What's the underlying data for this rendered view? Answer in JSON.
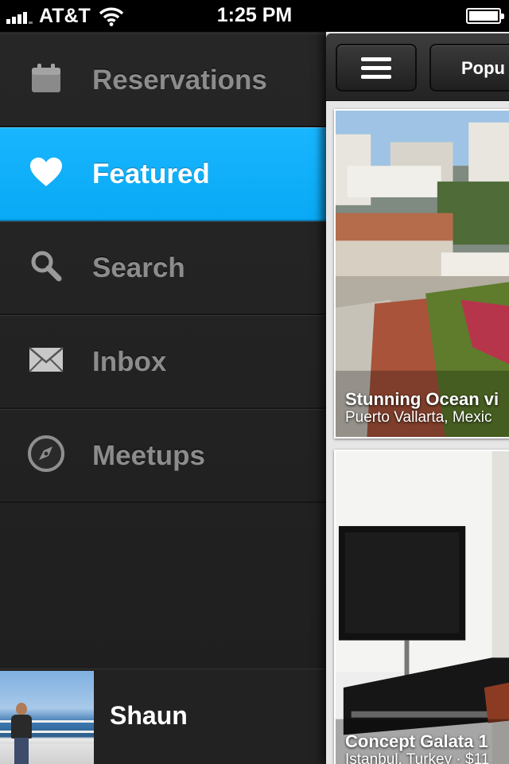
{
  "status_bar": {
    "carrier": "AT&T",
    "time": "1:25 PM",
    "signal_bars_filled": 4,
    "signal_bars_total": 5,
    "wifi_icon": "wifi-icon",
    "battery_icon": "battery-icon"
  },
  "sidebar": {
    "items": [
      {
        "label": "Reservations",
        "icon": "calendar-icon",
        "active": false
      },
      {
        "label": "Featured",
        "icon": "heart-icon",
        "active": true
      },
      {
        "label": "Search",
        "icon": "search-icon",
        "active": false
      },
      {
        "label": "Inbox",
        "icon": "envelope-icon",
        "active": false
      },
      {
        "label": "Meetups",
        "icon": "compass-icon",
        "active": false
      }
    ],
    "profile": {
      "name": "Shaun"
    }
  },
  "main": {
    "menu_button_icon": "hamburger-icon",
    "tab_label": "Popu",
    "listings": [
      {
        "title": "Stunning Ocean vi",
        "subtitle": "Puerto Vallarta, Mexic"
      },
      {
        "title": "Concept Galata 1",
        "subtitle": "Istanbul, Turkey · $11"
      }
    ]
  },
  "colors": {
    "accent": "#0aabf7",
    "sidebar_bg": "#232323",
    "label_inactive": "#8c8c8c"
  }
}
